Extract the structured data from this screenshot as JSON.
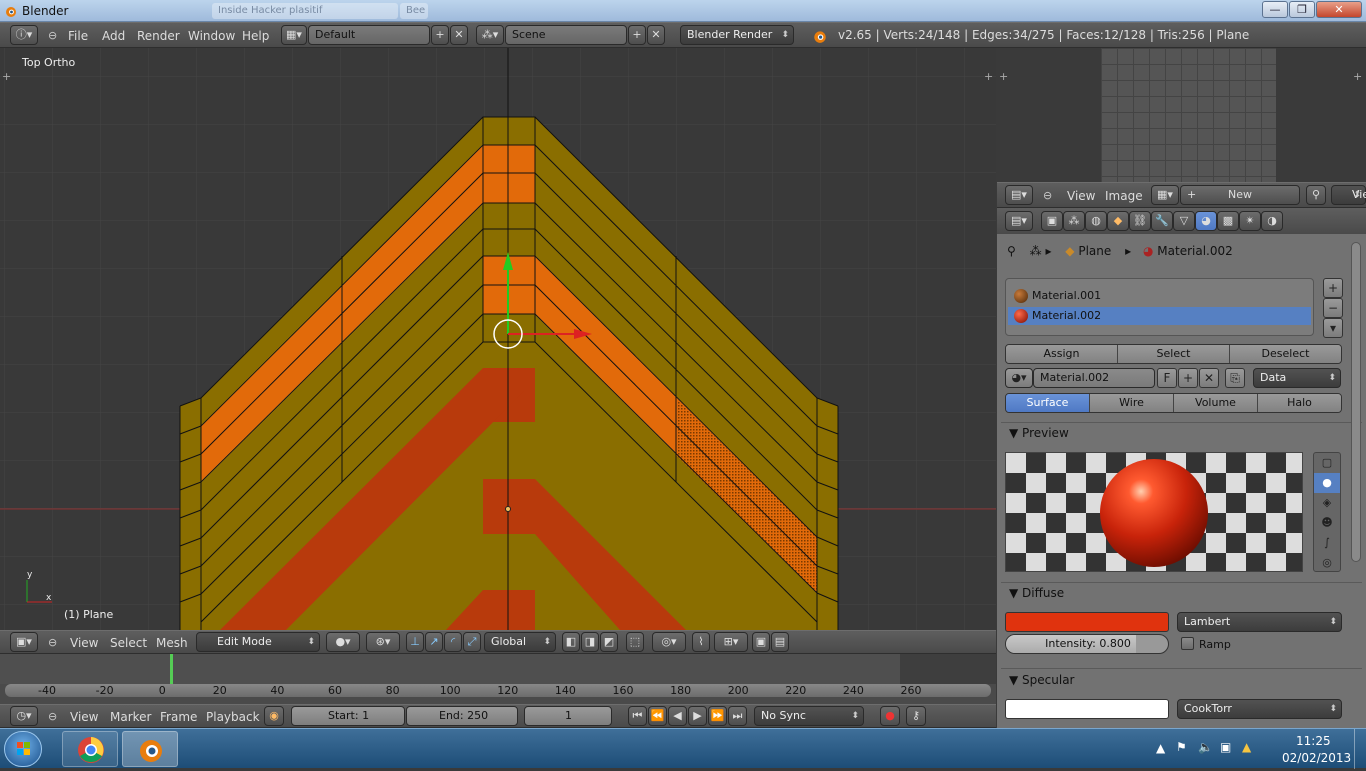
{
  "window": {
    "title": "Blender",
    "ghost_tabs": [
      "Inside Hacker plasitif",
      "Bee"
    ],
    "btn_min": "—",
    "btn_max": "❐",
    "btn_close": "✕"
  },
  "info_header": {
    "menus": [
      "File",
      "Add",
      "Render",
      "Window",
      "Help"
    ],
    "layout": "Default",
    "scene": "Scene",
    "engine": "Blender Render",
    "stats": "v2.65 | Verts:24/148 | Edges:34/275 | Faces:12/128 | Tris:256 | Plane"
  },
  "viewport": {
    "view_label": "Top Ortho",
    "object_label": "(1) Plane",
    "menus": [
      "View",
      "Select",
      "Mesh"
    ],
    "mode": "Edit Mode",
    "orientation": "Global",
    "colors": {
      "mesh": "#8a6e00",
      "selected": "#e26a0a",
      "material2": "#b83a0c"
    }
  },
  "image_editor": {
    "menus": [
      "View",
      "Image"
    ],
    "new_label": "New",
    "view_label": "Vie"
  },
  "properties": {
    "breadcrumb": {
      "object": "Plane",
      "material": "Material.002"
    },
    "material_slots": [
      "Material.001",
      "Material.002"
    ],
    "selected_slot": "Material.002",
    "slot_buttons": {
      "assign": "Assign",
      "select": "Select",
      "deselect": "Deselect"
    },
    "material_name": "Material.002",
    "fake_user": "F",
    "link": "Data",
    "tabs": [
      "Surface",
      "Wire",
      "Volume",
      "Halo"
    ],
    "active_tab": "Surface",
    "preview_title": "Preview",
    "diffuse_title": "Diffuse",
    "diffuse_color": "#e0330e",
    "diffuse_shader": "Lambert",
    "intensity_label": "Intensity: 0.800",
    "intensity_value": 0.8,
    "ramp_label": "Ramp",
    "specular_title": "Specular",
    "specular_color": "#ffffff",
    "specular_shader": "CookTorr"
  },
  "timeline": {
    "ruler": [
      "-40",
      "-20",
      "0",
      "20",
      "40",
      "60",
      "80",
      "100",
      "120",
      "140",
      "160",
      "180",
      "200",
      "220",
      "240",
      "260"
    ],
    "menus": [
      "View",
      "Marker",
      "Frame",
      "Playback"
    ],
    "start": "Start: 1",
    "end": "End: 250",
    "current": "1",
    "sync": "No Sync"
  },
  "taskbar": {
    "time": "11:25",
    "date": "02/02/2013"
  }
}
